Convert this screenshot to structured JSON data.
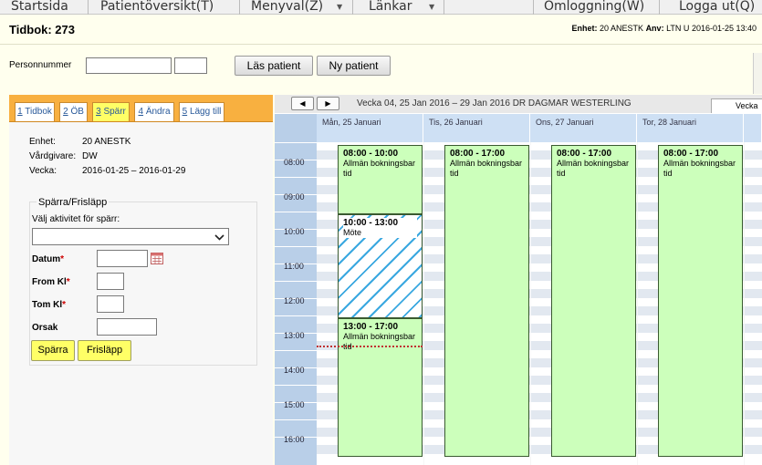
{
  "menubar": {
    "items": [
      {
        "label": "Startsida"
      },
      {
        "label": "Patientöversikt(T)"
      },
      {
        "label": "Menyval(Z)"
      },
      {
        "label": "Länkar"
      },
      {
        "label": "Omloggning(W)"
      },
      {
        "label": "Logga ut(Q)"
      }
    ]
  },
  "header": {
    "title": "Tidbok: 273",
    "unit_label": "Enhet:",
    "unit_value": "20 ANESTK",
    "user_label": "Anv:",
    "user_value": "LTN U",
    "datetime": "2016-01-25 13:40"
  },
  "patient_bar": {
    "label": "Personnummer",
    "input1_value": "",
    "input2_value": "",
    "read_button": "Läs patient",
    "new_button": "Ny patient"
  },
  "tabs": [
    {
      "num": "1",
      "label": "Tidbok"
    },
    {
      "num": "2",
      "label": "ÖB"
    },
    {
      "num": "3",
      "label": "Spärr",
      "active": true
    },
    {
      "num": "4",
      "label": "Ändra"
    },
    {
      "num": "5",
      "label": "Lägg till"
    }
  ],
  "info": {
    "unit_label": "Enhet:",
    "unit_value": "20 ANESTK",
    "caregiver_label": "Vårdgivare:",
    "caregiver_value": "DW",
    "week_label": "Vecka:",
    "week_value": "2016-01-25 – 2016-01-29"
  },
  "form": {
    "legend": "Spärra/Frisläpp",
    "activity_label": "Välj aktivitet för spärr:",
    "activity_value": "",
    "date_label": "Datum",
    "from_label": "From Kl",
    "to_label": "Tom Kl",
    "reason_label": "Orsak",
    "required_mark": "*",
    "date_value": "",
    "from_value": "",
    "to_value": "",
    "reason_value": "",
    "block_button": "Spärra",
    "release_button": "Frisläpp"
  },
  "calendar": {
    "week_title": "Vecka 04, 25 Jan 2016 – 29 Jan 2016 DR DAGMAR WESTERLING",
    "week_tab_label": "Vecka",
    "days": [
      "Mån, 25 Januari",
      "Tis, 26 Januari",
      "Ons, 27 Januari",
      "Tor, 28 Januari"
    ],
    "hours": [
      "08:00",
      "09:00",
      "10:00",
      "11:00",
      "12:00",
      "13:00",
      "14:00",
      "15:00",
      "16:00"
    ],
    "events": [
      {
        "day": 0,
        "time": "08:00 - 10:00",
        "desc": "Allmän bokningsbar tid",
        "type": "open"
      },
      {
        "day": 0,
        "time": "10:00 - 13:00",
        "desc": "Möte",
        "type": "blocked"
      },
      {
        "day": 0,
        "time": "13:00 - 17:00",
        "desc": "Allmän bokningsbar tid",
        "type": "open"
      },
      {
        "day": 1,
        "time": "08:00 - 17:00",
        "desc": "Allmän bokningsbar tid",
        "type": "open"
      },
      {
        "day": 2,
        "time": "08:00 - 17:00",
        "desc": "Allmän bokningsbar tid",
        "type": "open"
      },
      {
        "day": 3,
        "time": "08:00 - 17:00",
        "desc": "Allmän bokningsbar tid",
        "type": "open"
      }
    ]
  },
  "colors": {
    "tabbar": "#f8b040",
    "highlight": "#ffff66",
    "event_open": "#ccffbb",
    "blocked_hatch": "#3aa8e0",
    "day_header": "#cee0f4"
  }
}
